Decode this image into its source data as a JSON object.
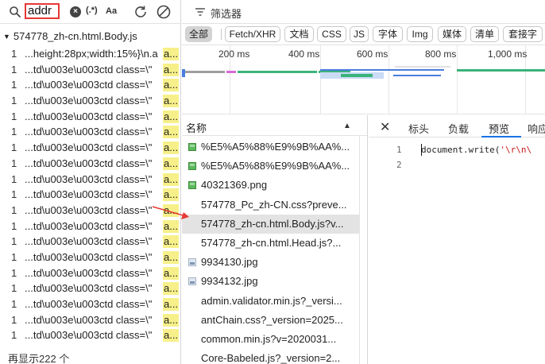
{
  "search": {
    "query": "addr",
    "regex_label": "(.*)",
    "case_label": "Aa",
    "file_name": "574778_zh-cn.html.Body.js",
    "results": [
      {
        "line": "1",
        "text": "...height:28px;width:15%}\\n.a",
        "match": "a..."
      },
      {
        "line": "1",
        "text": "...td\\u003e\\u003ctd class=\\\"",
        "match": "a..."
      },
      {
        "line": "1",
        "text": "...td\\u003e\\u003ctd class=\\\"",
        "match": "a..."
      },
      {
        "line": "1",
        "text": "...td\\u003e\\u003ctd class=\\\"",
        "match": "a..."
      },
      {
        "line": "1",
        "text": "...td\\u003e\\u003ctd class=\\\"",
        "match": "a..."
      },
      {
        "line": "1",
        "text": "...td\\u003e\\u003ctd class=\\\"",
        "match": "a..."
      },
      {
        "line": "1",
        "text": "...td\\u003e\\u003ctd class=\\\"",
        "match": "a..."
      },
      {
        "line": "1",
        "text": "...td\\u003e\\u003ctd class=\\\"",
        "match": "a..."
      },
      {
        "line": "1",
        "text": "...td\\u003e\\u003ctd class=\\\"",
        "match": "a..."
      },
      {
        "line": "1",
        "text": "...td\\u003e\\u003ctd class=\\\"",
        "match": "a..."
      },
      {
        "line": "1",
        "text": "...td\\u003e\\u003ctd class=\\\"",
        "match": "a..."
      },
      {
        "line": "1",
        "text": "...td\\u003e\\u003ctd class=\\\"",
        "match": "a..."
      },
      {
        "line": "1",
        "text": "...td\\u003e\\u003ctd class=\\\"",
        "match": "a..."
      },
      {
        "line": "1",
        "text": "...td\\u003e\\u003ctd class=\\\"",
        "match": "a..."
      },
      {
        "line": "1",
        "text": "...td\\u003e\\u003ctd class=\\\"",
        "match": "a..."
      },
      {
        "line": "1",
        "text": "...td\\u003e\\u003ctd class=\\\"",
        "match": "a..."
      },
      {
        "line": "1",
        "text": "...td\\u003e\\u003ctd class=\\\"",
        "match": "a..."
      },
      {
        "line": "1",
        "text": "...td\\u003e\\u003ctd class=\\\"",
        "match": "a..."
      },
      {
        "line": "1",
        "text": "...td\\u003e\\u003ctd class=\\\"",
        "match": "a..."
      }
    ],
    "footer": "再显示222 个"
  },
  "filter": {
    "placeholder": "筛选器",
    "types": [
      "全部",
      "Fetch/XHR",
      "文档",
      "CSS",
      "JS",
      "字体",
      "Img",
      "媒体",
      "清单",
      "套接字"
    ],
    "active_type": "全部"
  },
  "timeline": {
    "ticks": [
      "200 ms",
      "400 ms",
      "600 ms",
      "800 ms",
      "1,000 ms"
    ]
  },
  "requests": {
    "header": "名称",
    "items": [
      {
        "name": "%E5%A5%88%E9%9B%AA%...",
        "icon": "image-icon"
      },
      {
        "name": "%E5%A5%88%E9%9B%AA%...",
        "icon": "image-icon"
      },
      {
        "name": "40321369.png",
        "icon": "image-icon"
      },
      {
        "name": "574778_Pc_zh-CN.css?preve...",
        "icon": "none"
      },
      {
        "name": "574778_zh-cn.html.Body.js?v...",
        "icon": "none"
      },
      {
        "name": "574778_zh-cn.html.Head.js?...",
        "icon": "none"
      },
      {
        "name": "9934130.jpg",
        "icon": "jpg-icon"
      },
      {
        "name": "9934132.jpg",
        "icon": "jpg-icon"
      },
      {
        "name": "admin.validator.min.js?_versi...",
        "icon": "none"
      },
      {
        "name": "antChain.css?_version=2025...",
        "icon": "none"
      },
      {
        "name": "common.min.js?v=2020031...",
        "icon": "none"
      },
      {
        "name": "Core-Babeled.js?_version=2...",
        "icon": "none"
      }
    ],
    "selected_index": 4
  },
  "detail": {
    "tabs": [
      "标头",
      "负载",
      "预览",
      "响应"
    ],
    "active_tab": "预览",
    "code_lines": [
      {
        "no": "1",
        "code": "document.write(",
        "str": "'\\r\\n\\"
      },
      {
        "no": "2",
        "code": "",
        "str": ""
      }
    ]
  },
  "colors": {
    "highlight": "#f7f08a",
    "search_box_border": "#e53935",
    "tab_underline": "#1a73e8",
    "waterfall_green": "#3bb37a",
    "waterfall_blue": "#4a7ddf",
    "annotation_arrow": "#e53935"
  }
}
